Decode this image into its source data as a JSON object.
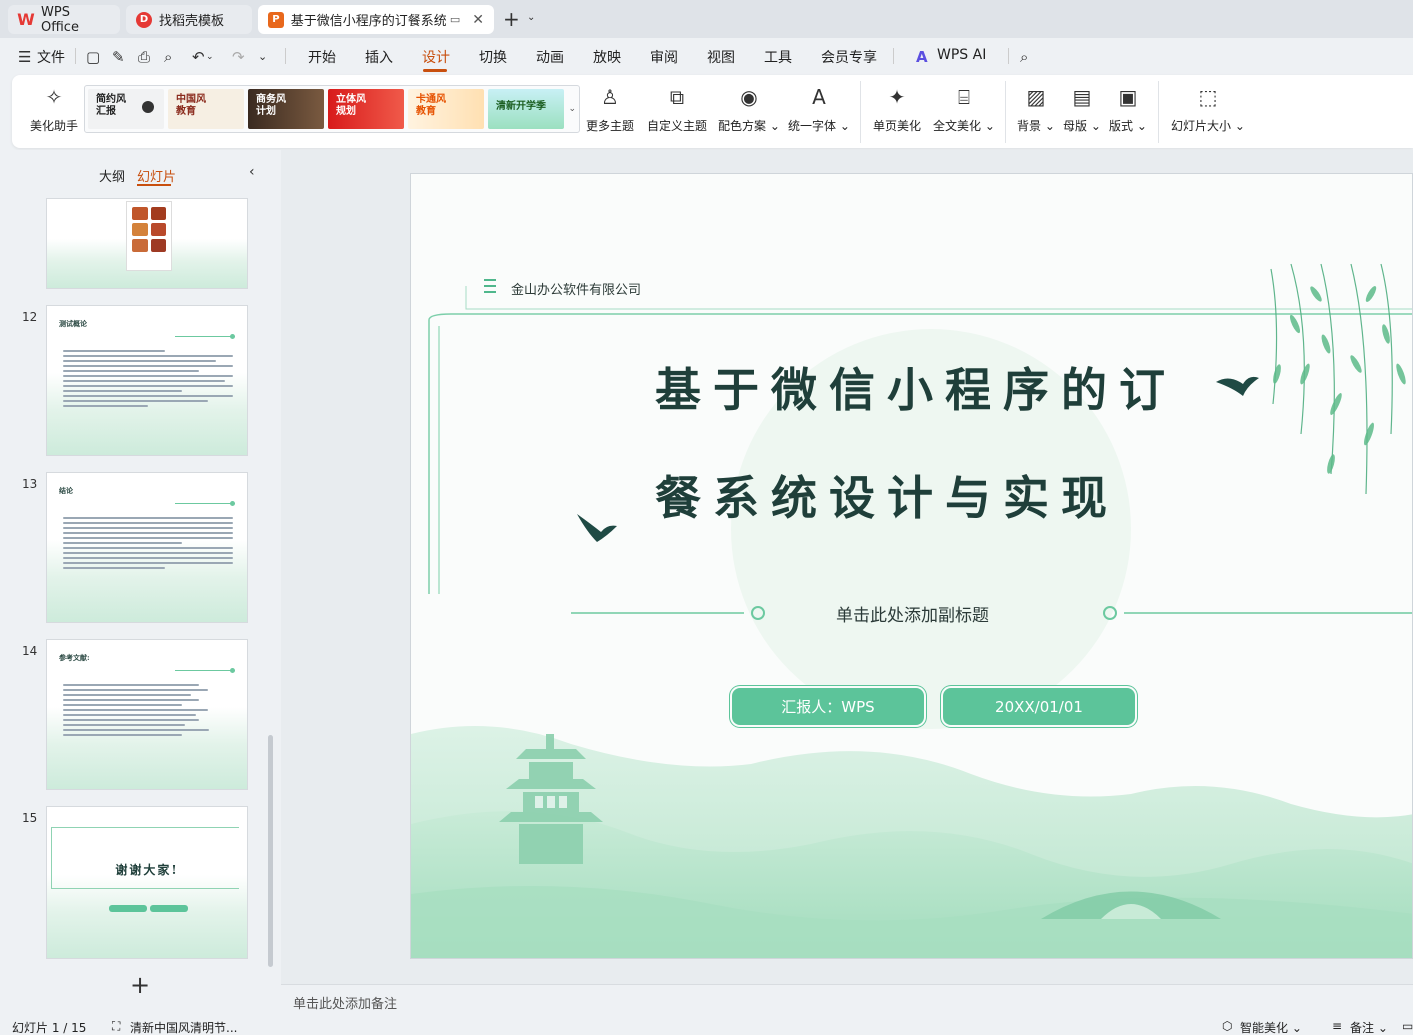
{
  "tabs": [
    {
      "label": "WPS Office"
    },
    {
      "label": "找稻壳模板"
    },
    {
      "label": "基于微信小程序的订餐系统设"
    }
  ],
  "menu": {
    "file": "文件",
    "items": [
      "开始",
      "插入",
      "设计",
      "切换",
      "动画",
      "放映",
      "审阅",
      "视图",
      "工具",
      "会员专享"
    ],
    "ai": "WPS AI"
  },
  "ribbon": {
    "beautify": "美化助手",
    "themes": [
      {
        "label1": "简约风",
        "label2": "汇报"
      },
      {
        "label1": "中国风",
        "label2": "教育"
      },
      {
        "label1": "商务风",
        "label2": "计划"
      },
      {
        "label1": "立体风",
        "label2": "规划"
      },
      {
        "label1": "卡通风",
        "label2": "教育"
      },
      {
        "label1": "清新开学季",
        "label2": ""
      }
    ],
    "more_themes": "更多主题",
    "custom_theme": "自定义主题",
    "color_scheme": "配色方案",
    "unify_font": "统一字体",
    "single_beautify": "单页美化",
    "full_beautify": "全文美化",
    "background": "背景",
    "master": "母版",
    "layout": "版式",
    "slide_size": "幻灯片大小"
  },
  "left_panel": {
    "outline_tab": "大纲",
    "slides_tab": "幻灯片",
    "thumbs": [
      {
        "num": "",
        "title": ""
      },
      {
        "num": "12",
        "title": "测试概论"
      },
      {
        "num": "13",
        "title": "结论"
      },
      {
        "num": "14",
        "title": "参考文献:"
      },
      {
        "num": "15",
        "title": "谢谢大家!"
      }
    ]
  },
  "slide": {
    "company": "金山办公软件有限公司",
    "title_line1": "基于微信小程序的订",
    "title_line2": "餐系统设计与实现",
    "subtitle": "单击此处添加副标题",
    "reporter": "汇报人：WPS",
    "date": "20XX/01/01"
  },
  "notes_placeholder": "单击此处添加备注",
  "status": {
    "slide_counter": "幻灯片 1 / 15",
    "theme_name": "清新中国风清明节...",
    "smart_beautify": "智能美化",
    "notes": "备注"
  },
  "colors": {
    "accent": "#c84f0e",
    "slide_green": "#5cc49a",
    "title_dark": "#1f3f3a"
  }
}
